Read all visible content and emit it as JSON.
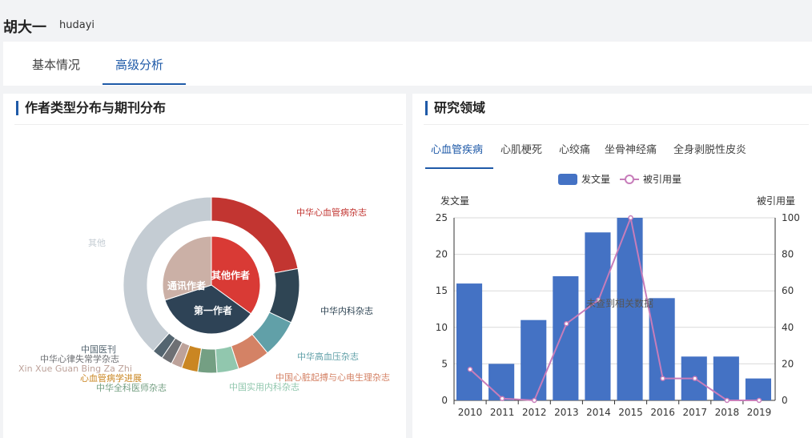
{
  "header": {
    "name": "胡大一",
    "username": "hudayi"
  },
  "tabs": [
    {
      "label": "基本情况"
    },
    {
      "label": "高级分析"
    }
  ],
  "left_panel": {
    "title": "作者类型分布与期刊分布"
  },
  "right_panel": {
    "title": "研究领域",
    "subtabs": [
      {
        "label": "心血管疾病"
      },
      {
        "label": "心肌梗死"
      },
      {
        "label": "心绞痛"
      },
      {
        "label": "坐骨神经痛"
      },
      {
        "label": "全身剥脱性皮炎"
      }
    ]
  },
  "chart_data": [
    {
      "type": "pie",
      "inner": [
        {
          "name": "其他作者",
          "value": 35,
          "color": "#d93a35"
        },
        {
          "name": "第一作者",
          "value": 35,
          "color": "#2e4356"
        },
        {
          "name": "通讯作者",
          "value": 30,
          "color": "#cbb0a6"
        }
      ],
      "outer": [
        {
          "name": "中华心血管病杂志",
          "value": 22,
          "color": "#c23531"
        },
        {
          "name": "中华内科杂志",
          "value": 10,
          "color": "#2f4554"
        },
        {
          "name": "中华高血压杂志",
          "value": 7,
          "color": "#61a0a8"
        },
        {
          "name": "中国心脏起搏与心电生理杂志",
          "value": 6,
          "color": "#d48265"
        },
        {
          "name": "中国实用内科杂志",
          "value": 4,
          "color": "#91c7ae"
        },
        {
          "name": "中华全科医师杂志",
          "value": 3.5,
          "color": "#749f83"
        },
        {
          "name": "心血管病学进展",
          "value": 3,
          "color": "#ca8622"
        },
        {
          "name": "Xin Xue Guan Bing Za Zhi",
          "value": 2,
          "color": "#bda29a"
        },
        {
          "name": "中华心律失常学杂志",
          "value": 2,
          "color": "#6e7074"
        },
        {
          "name": "中国医刊",
          "value": 2,
          "color": "#546570"
        },
        {
          "name": "其他",
          "value": 38.5,
          "color": "#c4ccd3"
        }
      ]
    },
    {
      "type": "bar",
      "legend": [
        "发文量",
        "被引用量"
      ],
      "categories": [
        "2010",
        "2011",
        "2012",
        "2013",
        "2014",
        "2015",
        "2016",
        "2017",
        "2018",
        "2019"
      ],
      "series": [
        {
          "name": "发文量",
          "type": "bar",
          "values": [
            16,
            5,
            11,
            17,
            23,
            25,
            14,
            6,
            6,
            3
          ],
          "color": "#4472c4"
        },
        {
          "name": "被引用量",
          "type": "line",
          "values": [
            17,
            1,
            0,
            42,
            55,
            100,
            12,
            12,
            0,
            0
          ],
          "color": "#c77dba"
        }
      ],
      "ylabel_left": "发文量",
      "ylabel_right": "被引用量",
      "ylim_left": [
        0,
        25
      ],
      "ylim_right": [
        0,
        100
      ],
      "yticks_left": [
        "0",
        "5",
        "10",
        "15",
        "20",
        "25"
      ],
      "yticks_right": [
        "0",
        "20",
        "40",
        "60",
        "80",
        "100"
      ],
      "overlay_text": "未查到相关数据",
      "grid": true,
      "legend_position": "top-center"
    }
  ]
}
